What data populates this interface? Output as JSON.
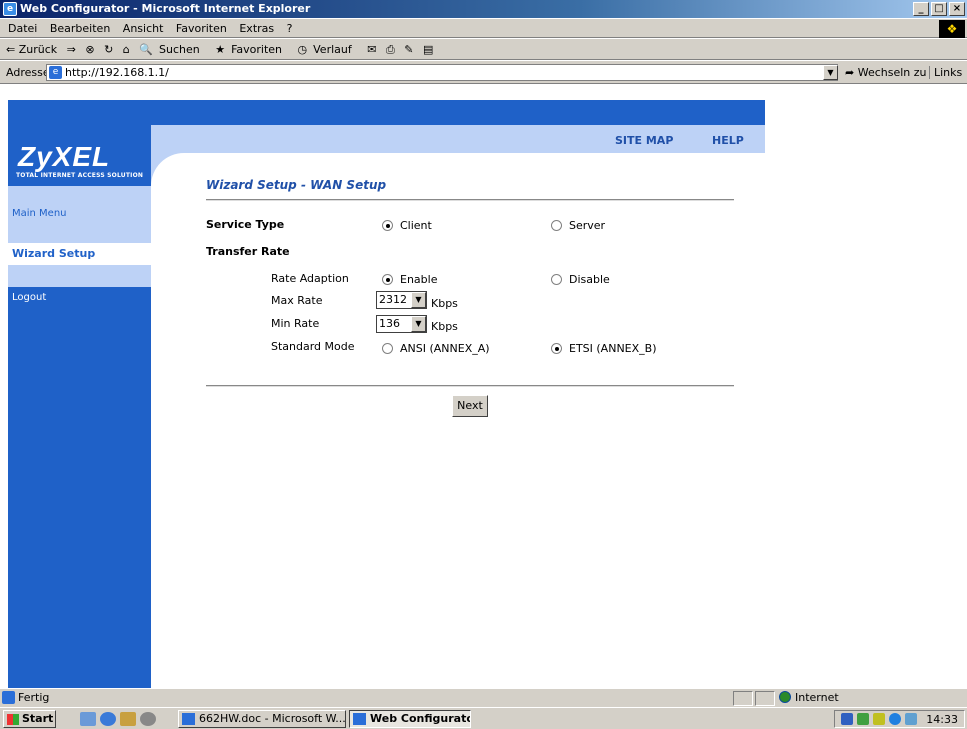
{
  "window": {
    "title": "Web Configurator - Microsoft Internet Explorer",
    "buttons": [
      "_",
      "□",
      "×"
    ]
  },
  "menubar": [
    "Datei",
    "Bearbeiten",
    "Ansicht",
    "Favoriten",
    "Extras",
    "?"
  ],
  "toolbar": {
    "back": "⇐ Zurück",
    "forward": "⇒",
    "search": "Suchen",
    "favorites": "Favoriten",
    "history": "Verlauf"
  },
  "address": {
    "label": "Adresse",
    "url": "http://192.168.1.1/",
    "go": "Wechseln zu",
    "links": "Links"
  },
  "brand": {
    "logo": "ZyXEL",
    "tagline": "TOTAL INTERNET ACCESS SOLUTION"
  },
  "topnav": {
    "sitemap": "SITE MAP",
    "help": "HELP"
  },
  "sidebar": {
    "items": [
      {
        "label": "Main Menu"
      },
      {
        "label": "Wizard Setup"
      },
      {
        "label": "Logout"
      }
    ]
  },
  "page": {
    "title": "Wizard Setup - WAN Setup",
    "service_type": {
      "label": "Service Type",
      "options": [
        "Client",
        "Server"
      ],
      "selected": "Client"
    },
    "transfer_rate": {
      "label": "Transfer Rate"
    },
    "rate_adaption": {
      "label": "Rate Adaption",
      "options": [
        "Enable",
        "Disable"
      ],
      "selected": "Enable"
    },
    "max_rate": {
      "label": "Max Rate",
      "value": "2312",
      "unit": "Kbps"
    },
    "min_rate": {
      "label": "Min Rate",
      "value": "136",
      "unit": "Kbps"
    },
    "standard_mode": {
      "label": "Standard Mode",
      "options": [
        "ANSI (ANNEX_A)",
        "ETSI (ANNEX_B)"
      ],
      "selected": "ETSI (ANNEX_B)"
    },
    "next": "Next"
  },
  "status": {
    "text": "Fertig",
    "zone": "Internet"
  },
  "taskbar": {
    "start": "Start",
    "tasks": [
      "662HW.doc - Microsoft W...",
      "Web Configurator - Mi..."
    ],
    "clock": "14:33"
  }
}
